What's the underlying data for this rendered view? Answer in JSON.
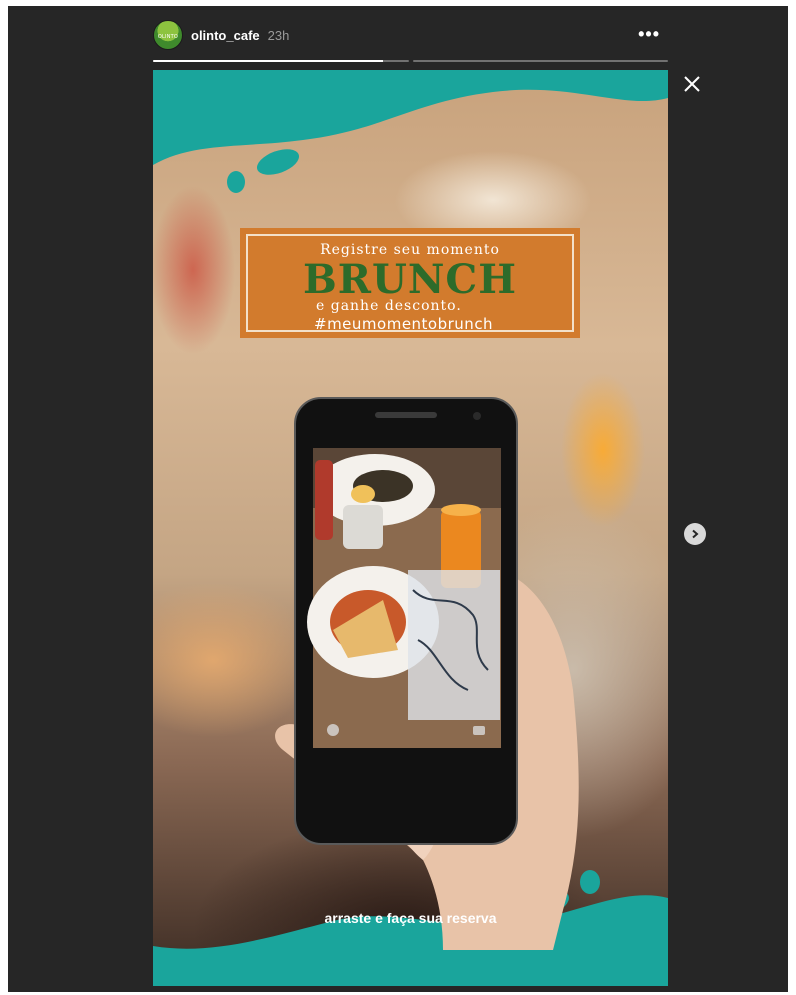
{
  "header": {
    "avatar_text": "OLINTO",
    "username": "olinto_cafe",
    "timestamp": "23h",
    "more_label": "•••"
  },
  "progress": {
    "segments": [
      {
        "fill": 0.9
      },
      {
        "fill": 0
      }
    ]
  },
  "story": {
    "promo_line1": "Registre seu momento",
    "promo_title": "BRUNCH",
    "promo_line2": "e ganhe desconto.",
    "promo_hashtag": "#meumomentobrunch",
    "cta": "arraste e faça sua reserva"
  },
  "colors": {
    "viewer_bg": "#262626",
    "teal": "#1aa59c",
    "promo_bg": "#d27b2d",
    "promo_title": "#2d6b2a"
  },
  "icons": {
    "close": "close-icon",
    "next": "chevron-right-icon",
    "more": "more-horizontal-icon"
  }
}
